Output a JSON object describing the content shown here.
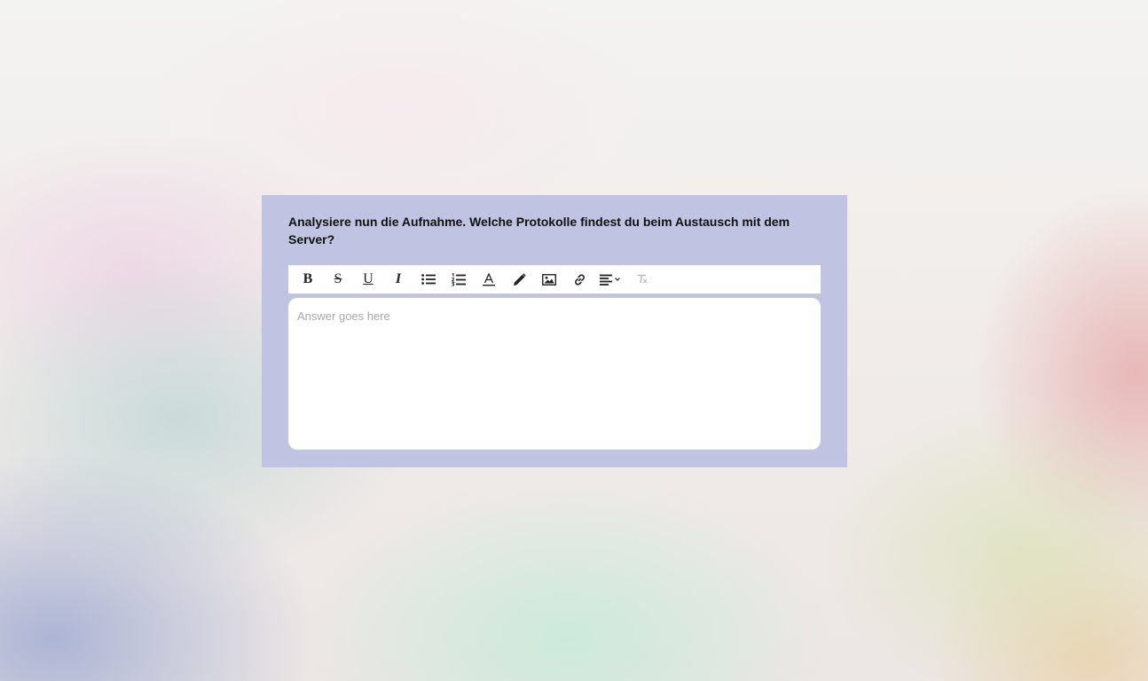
{
  "question": {
    "text": "Analysiere nun die Aufnahme. Welche Protokolle findest du beim Austausch mit dem Server?"
  },
  "toolbar": {
    "bold_label": "B",
    "strikethrough_label": "S",
    "underline_label": "U",
    "italic_label": "I",
    "icons": [
      "bold-icon",
      "strikethrough-icon",
      "underline-icon",
      "italic-icon",
      "bulleted-list-icon",
      "numbered-list-icon",
      "text-color-icon",
      "pencil-icon",
      "image-icon",
      "link-icon",
      "align-left-icon",
      "clear-formatting-icon"
    ]
  },
  "answer": {
    "value": "",
    "placeholder": "Answer goes here"
  },
  "colors": {
    "card_background": "#c0c3e2",
    "toolbar_background": "#ffffff",
    "editor_background": "#ffffff",
    "placeholder_text": "#a7a7a7",
    "disabled_icon": "#bbbbbb"
  }
}
